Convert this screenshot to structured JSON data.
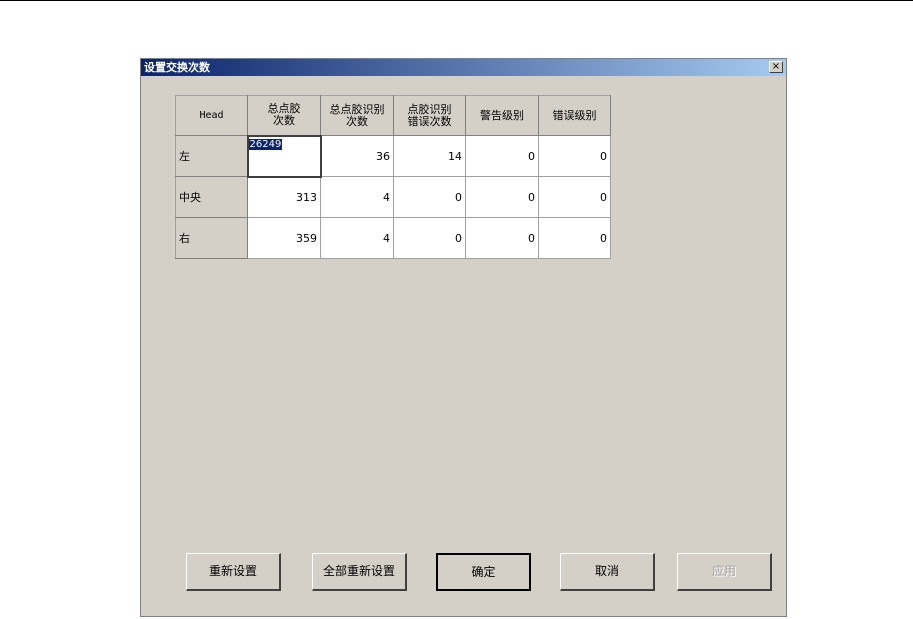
{
  "dialog": {
    "title": "设置交换次数",
    "close_label": "×"
  },
  "grid": {
    "headers": [
      "Head",
      "总点胶\n次数",
      "总点胶识别\n次数",
      "点胶识别\n错误次数",
      "警告级别",
      "错误级别"
    ],
    "rows": [
      {
        "label": "左",
        "values": [
          "26249",
          "36",
          "14",
          "0",
          "0"
        ]
      },
      {
        "label": "中央",
        "values": [
          "313",
          "4",
          "0",
          "0",
          "0"
        ]
      },
      {
        "label": "右",
        "values": [
          "359",
          "4",
          "0",
          "0",
          "0"
        ]
      }
    ]
  },
  "buttons": {
    "reset": "重新设置",
    "reset_all": "全部重新设置",
    "ok": "确定",
    "cancel": "取消",
    "apply": "应用"
  }
}
